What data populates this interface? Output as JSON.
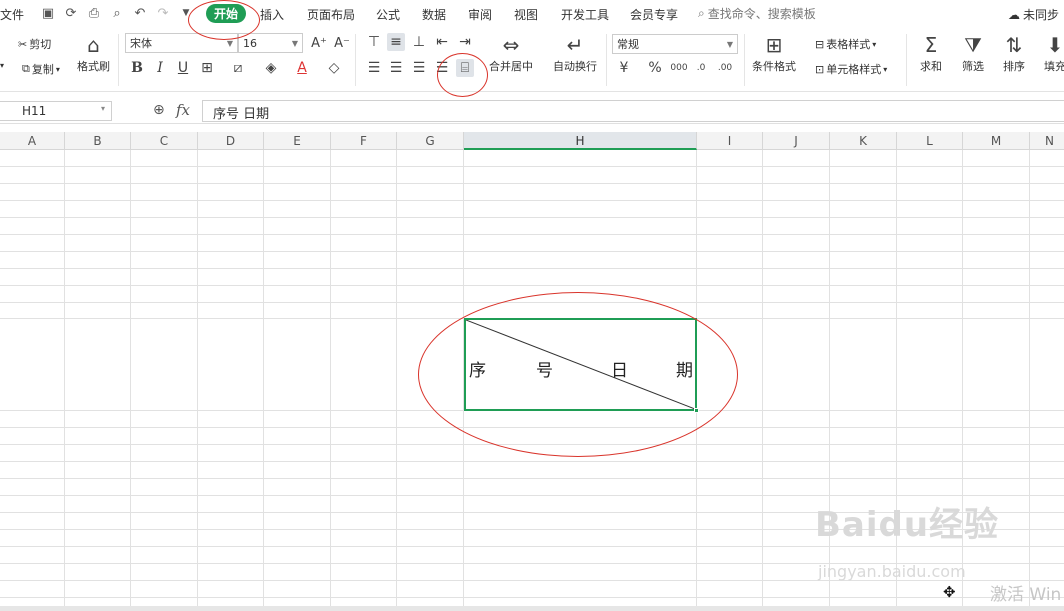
{
  "menubar": {
    "file": "文件",
    "tabs": [
      "开始",
      "插入",
      "页面布局",
      "公式",
      "数据",
      "审阅",
      "视图",
      "开发工具",
      "会员专享"
    ],
    "active_tab": "开始",
    "search_placeholder": "查找命令、搜索模板",
    "sync_status": "未同步"
  },
  "ribbon": {
    "cut": "剪切",
    "copy": "复制",
    "format_painter": "格式刷",
    "font_name": "宋体",
    "font_size": "16",
    "merge_center": "合并居中",
    "wrap_text": "自动换行",
    "number_format": "常规",
    "table_style": "表格样式",
    "conditional_format": "条件格式",
    "cell_style": "单元格样式",
    "sum": "求和",
    "filter": "筛选",
    "sort": "排序",
    "fill": "填充"
  },
  "formula_bar": {
    "name_box": "H11",
    "fx": "fx",
    "content": "序号  日期"
  },
  "columns": [
    "A",
    "B",
    "C",
    "D",
    "E",
    "F",
    "G",
    "H",
    "I",
    "J",
    "K",
    "L",
    "M",
    "N"
  ],
  "active_column": "H",
  "cell": {
    "text_1": "序",
    "text_2": "号",
    "text_3": "日",
    "text_4": "期"
  },
  "watermark": {
    "logo": "Baidu经验",
    "url": "jingyan.baidu.com",
    "activate": "激活 Win"
  },
  "colors": {
    "accent_green": "#1f9d55",
    "annotation_red": "#d9342b"
  }
}
